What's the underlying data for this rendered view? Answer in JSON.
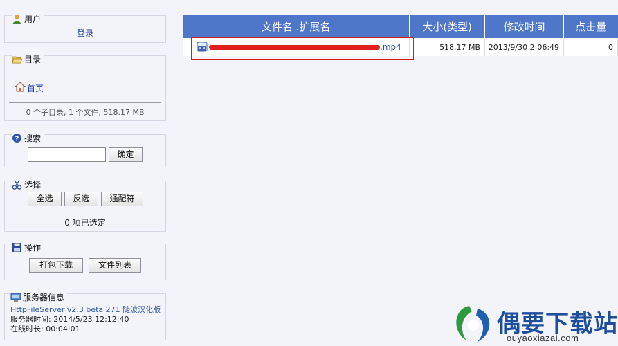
{
  "user": {
    "title": "用户",
    "login": "登录"
  },
  "dir": {
    "title": "目录",
    "home": "首页",
    "summary": "0 个子目录, 1 个文件, 518.17 MB"
  },
  "search": {
    "title": "搜索",
    "input_value": "",
    "button": "确定"
  },
  "select": {
    "title": "选择",
    "all": "全选",
    "invert": "反选",
    "wildcard": "通配符",
    "status": "0 项已选定"
  },
  "actions": {
    "title": "操作",
    "archive": "打包下载",
    "file_list": "文件列表"
  },
  "server": {
    "title": "服务器信息",
    "version": "HttpFileServer v2.3 beta 271 随波汉化版",
    "time": "服务器时间: 2014/5/23 12:12:40",
    "uptime": "在线时长: 00:04:01"
  },
  "table": {
    "headers": {
      "name": "文件名 .扩展名",
      "size": "大小(类型)",
      "modified": "修改时间",
      "hits": "点击量"
    },
    "rows": [
      {
        "name": ".mp4",
        "size": "518.17 MB",
        "modified": "2013/9/30 2:06:49",
        "hits": "0"
      }
    ]
  },
  "watermark": {
    "brand": "偶要下载站",
    "url": "ouyaoxiazai.com"
  },
  "colors": {
    "header_bg": "#4e76c9",
    "link": "#1f3ea8",
    "highlight_box": "#d21b1b",
    "redaction": "#e0201c"
  }
}
